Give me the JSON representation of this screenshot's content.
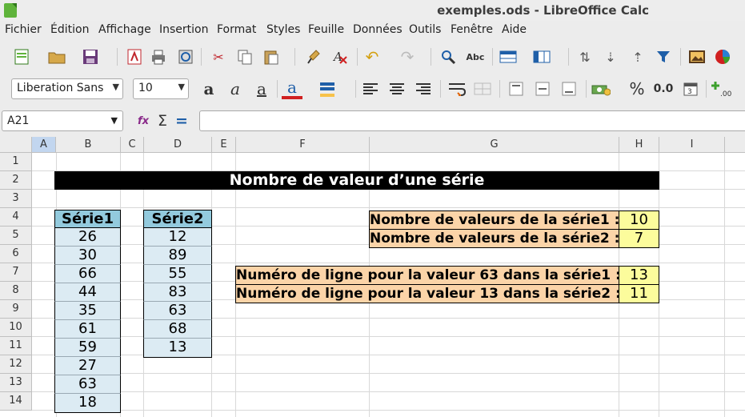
{
  "window": {
    "title": "exemples.ods - LibreOffice Calc"
  },
  "menu": [
    "Fichier",
    "Édition",
    "Affichage",
    "Insertion",
    "Format",
    "Styles",
    "Feuille",
    "Données",
    "Outils",
    "Fenêtre",
    "Aide"
  ],
  "font": {
    "name": "Liberation Sans",
    "size": "10"
  },
  "namebox": {
    "value": "A21"
  },
  "formula": {
    "value": ""
  },
  "icons": {
    "function_wizard": "fx",
    "sum": "Σ",
    "equals": "=",
    "bold": "a",
    "italic": "a",
    "underline": "a",
    "font_color": "a",
    "percent": "%",
    "number_format": "0.0"
  },
  "columns": [
    "A",
    "B",
    "C",
    "D",
    "E",
    "F",
    "G",
    "H",
    "I"
  ],
  "selected_column": "A",
  "rows": [
    "1",
    "2",
    "3",
    "4",
    "5",
    "6",
    "7",
    "8",
    "9",
    "10",
    "11",
    "12",
    "13",
    "14"
  ],
  "sheet": {
    "banner": "Nombre de valeur d’une série",
    "serie1": {
      "header": "Série1",
      "values": [
        "26",
        "30",
        "66",
        "44",
        "35",
        "61",
        "59",
        "27",
        "63",
        "18"
      ]
    },
    "serie2": {
      "header": "Série2",
      "values": [
        "12",
        "89",
        "55",
        "83",
        "63",
        "68",
        "13"
      ]
    },
    "count1": {
      "label": "Nombre de valeurs de la série1 :",
      "value": "10"
    },
    "count2": {
      "label": "Nombre de valeurs de la série2 :",
      "value": "7"
    },
    "match1": {
      "label": "Numéro de ligne pour la valeur 63 dans la série1 :",
      "value": "13"
    },
    "match2": {
      "label": "Numéro de ligne pour la valeur 13 dans la série2 :",
      "value": "11"
    }
  },
  "colors": {
    "header_blue": "#93cadd",
    "series_blue": "#dcebf3",
    "label_orange": "#fbd4a8",
    "value_yellow": "#fcfc9c",
    "banner": "#000000"
  }
}
